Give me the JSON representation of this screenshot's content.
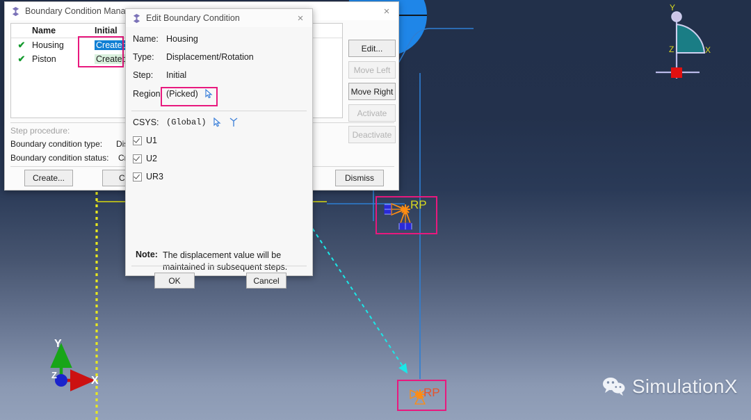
{
  "viewport": {
    "labels": {
      "axis_y": "Y",
      "axis_x": "X",
      "axis_z": "Z",
      "rp_top": "RP",
      "rp_bottom": "RP",
      "triad_y": "Y",
      "triad_x": "X",
      "triad_z": "Z"
    },
    "watermark": "SimulationX",
    "colors": {
      "bg_top": "#22304a",
      "bg_bottom": "#93a1ba",
      "geometry_line": "#2e7fd4",
      "axis_dotted": "#e8e81e",
      "rp_label_top": "#d8d81e",
      "rp_label_bottom": "#e8532a",
      "highlight_box": "#e8197e",
      "arrow_cyan": "#1ae8e8",
      "triad_teal": "#1a7d85"
    }
  },
  "manager": {
    "title": "Boundary Condition Manager",
    "title_icon": "abaqus-spool-icon",
    "close_label": "×",
    "columns": [
      "",
      "Name",
      "Initial"
    ],
    "rows": [
      {
        "check": "✔",
        "name": "Housing",
        "initial": "Created",
        "state": "selected"
      },
      {
        "check": "✔",
        "name": "Piston",
        "initial": "Created",
        "state": "green"
      }
    ],
    "side_buttons": [
      {
        "label": "Edit...",
        "enabled": true
      },
      {
        "label": "Move Left",
        "enabled": false
      },
      {
        "label": "Move Right",
        "enabled": true
      },
      {
        "label": "Activate",
        "enabled": false
      },
      {
        "label": "Deactivate",
        "enabled": false
      }
    ],
    "info": {
      "step_procedure": "Step procedure:",
      "bc_type_label": "Boundary condition type:",
      "bc_type_value": "Disp",
      "bc_status_label": "Boundary condition status:",
      "bc_status_value": "Cre"
    },
    "footer_buttons": [
      {
        "label": "Create...",
        "name": "create-button"
      },
      {
        "label": "Cop",
        "name": "copy-button"
      },
      {
        "label": "Dismiss",
        "name": "dismiss-button"
      }
    ]
  },
  "editor": {
    "title": "Edit Boundary Condition",
    "title_icon": "abaqus-spool-icon",
    "close_label": "×",
    "fields": [
      {
        "label": "Name:",
        "value": "Housing"
      },
      {
        "label": "Type:",
        "value": "Displacement/Rotation"
      },
      {
        "label": "Step:",
        "value": "Initial"
      },
      {
        "label": "Region:",
        "value": "(Picked)"
      }
    ],
    "csys": {
      "label": "CSYS:",
      "value": "(Global)"
    },
    "checkboxes": [
      {
        "label": "U1",
        "checked": true
      },
      {
        "label": "U2",
        "checked": true
      },
      {
        "label": "UR3",
        "checked": true
      }
    ],
    "note": {
      "prefix": "Note:",
      "line1": "The displacement value will be",
      "line2": "maintained in subsequent steps."
    },
    "buttons": [
      {
        "label": "OK",
        "name": "ok-button"
      },
      {
        "label": "Cancel",
        "name": "cancel-button"
      }
    ]
  }
}
